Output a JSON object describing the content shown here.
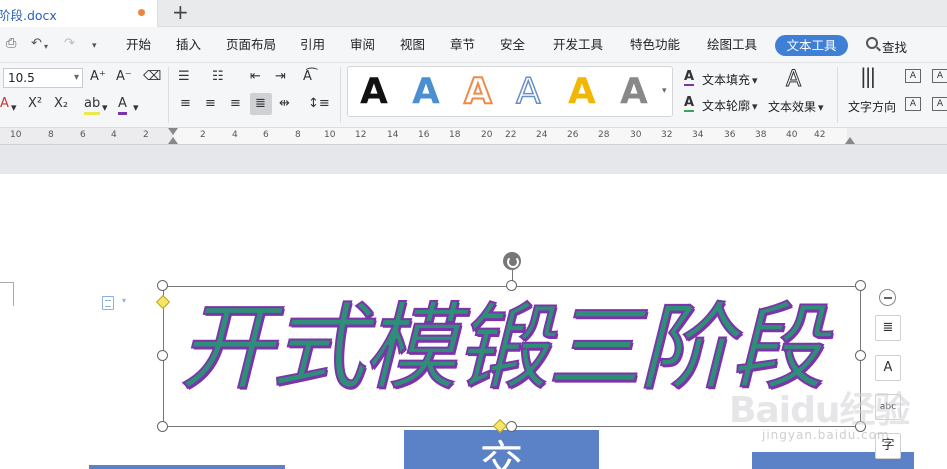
{
  "tab": {
    "title": "阶段.docx",
    "new_tab": "+"
  },
  "menu": {
    "items": [
      "开始",
      "插入",
      "页面布局",
      "引用",
      "审阅",
      "视图",
      "章节",
      "安全",
      "开发工具",
      "特色功能",
      "绘图工具"
    ],
    "active": "文本工具",
    "search": "查找"
  },
  "ribbon": {
    "font_size": "10.5",
    "font_grow": "A⁺",
    "font_shrink": "A⁻",
    "superscript": "X²",
    "subscript": "X₂",
    "text_fill": "文本填充",
    "text_outline": "文本轮廓",
    "text_effect": "文本效果",
    "text_direction": "文字方向",
    "gallery_glyph": "A",
    "colors": {
      "gallery": [
        "#111111",
        "#4a8fd0",
        "#f08a4b",
        "#6a8fc6",
        "#f2b705",
        "#888888"
      ],
      "accent": "#3f7fd6"
    }
  },
  "ruler": {
    "numbers": [
      "10",
      "8",
      "6",
      "4",
      "2",
      "2",
      "4",
      "6",
      "8",
      "10",
      "12",
      "14",
      "16",
      "18",
      "20",
      "22",
      "24",
      "26",
      "28",
      "30",
      "32",
      "34",
      "36",
      "38",
      "40",
      "42"
    ]
  },
  "document": {
    "wordart_text": "开式模锻三阶段",
    "wordart_fill": "#2e8f78",
    "wordart_outline": "#7b35a8",
    "shape_char": "交",
    "shape_color": "#5b81c6"
  },
  "float_tools": [
    "layout-options",
    "text-style",
    "abc",
    "字"
  ],
  "watermark": {
    "text": "Baidu经验",
    "sub": "jingyan.baidu.com"
  }
}
